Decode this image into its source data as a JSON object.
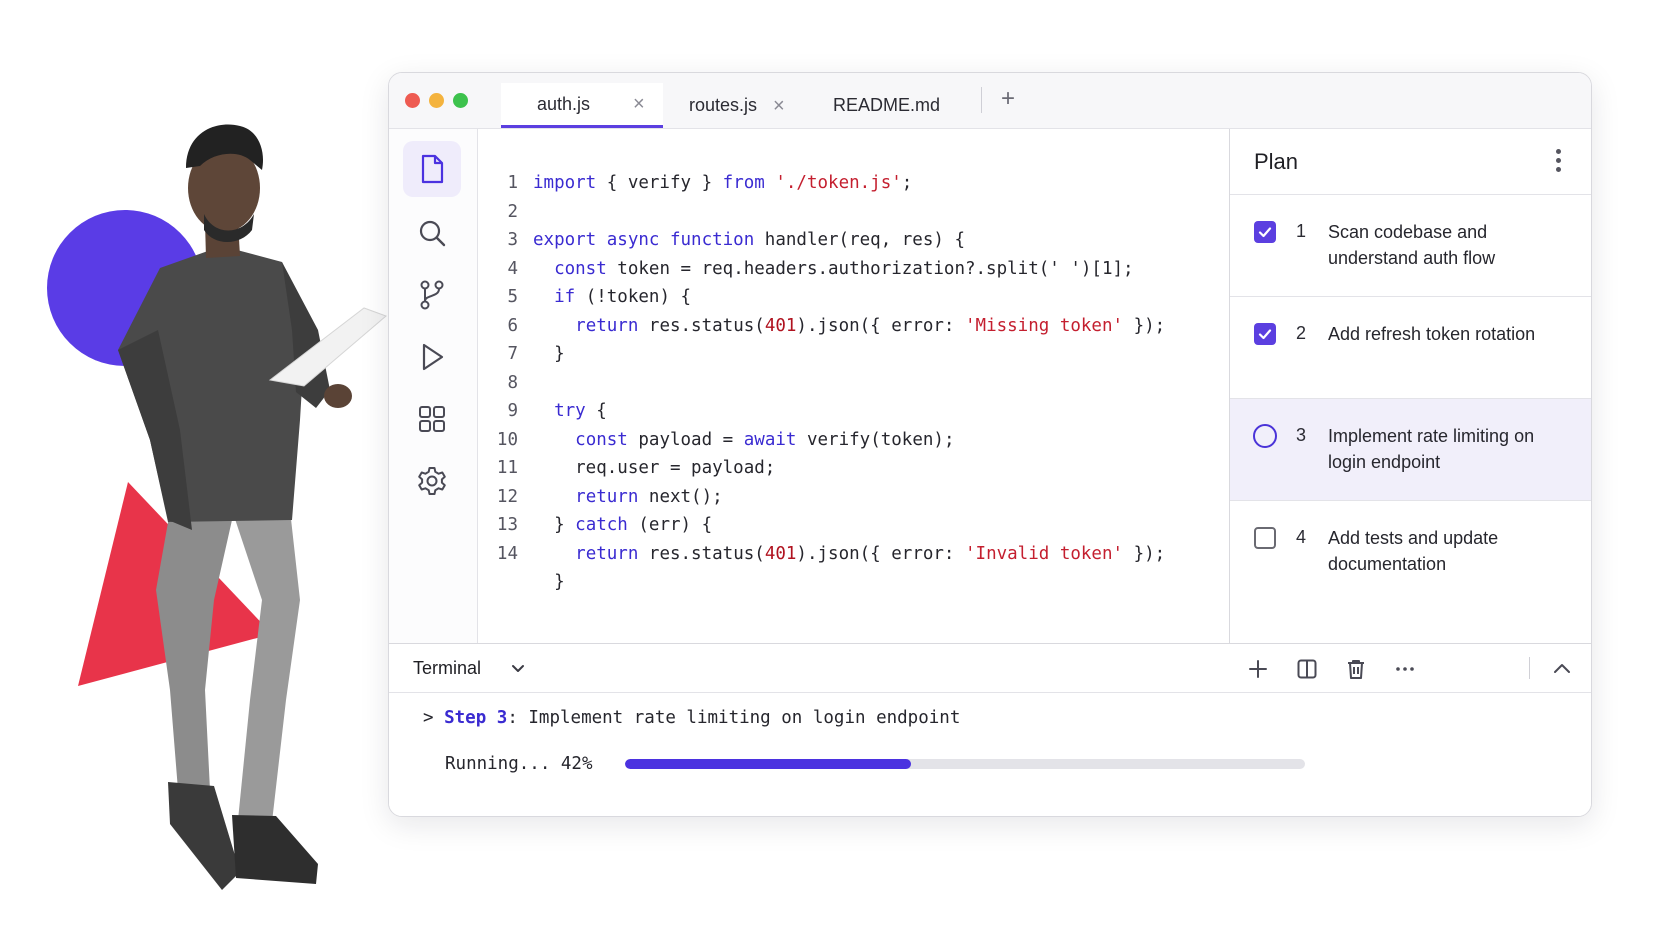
{
  "window": {
    "tabs": [
      {
        "label": "auth.js",
        "active": true
      },
      {
        "label": "routes.js",
        "active": false
      },
      {
        "label": "README.md",
        "active": false
      }
    ],
    "new_tab_label": "+",
    "tab_close_glyph": "×"
  },
  "activity_bar": {
    "icons": [
      "file-icon",
      "search-icon",
      "source-control-icon",
      "run-icon",
      "extensions-icon",
      "settings-icon"
    ],
    "active": "file-icon"
  },
  "editor": {
    "lines": [
      {
        "n": "1",
        "parts": [
          [
            "kw",
            "import"
          ],
          [
            "t",
            " { verify } "
          ],
          [
            "kw",
            "from"
          ],
          [
            "t",
            " "
          ],
          [
            "str",
            "'./token.js'"
          ],
          [
            "t",
            ";"
          ]
        ]
      },
      {
        "n": "2",
        "parts": []
      },
      {
        "n": "3",
        "parts": [
          [
            "kw",
            "export async function"
          ],
          [
            "t",
            " handler(req, res) {"
          ]
        ]
      },
      {
        "n": "4",
        "parts": [
          [
            "t",
            "  "
          ],
          [
            "kw",
            "const"
          ],
          [
            "t",
            " token = req.headers.authorization?.split(' ')[1];"
          ]
        ]
      },
      {
        "n": "5",
        "parts": [
          [
            "t",
            "  "
          ],
          [
            "kw",
            "if"
          ],
          [
            "t",
            " (!token) {"
          ]
        ]
      },
      {
        "n": "6",
        "parts": [
          [
            "t",
            "    "
          ],
          [
            "kw",
            "return"
          ],
          [
            "t",
            " res.status("
          ],
          [
            "num",
            "401"
          ],
          [
            "t",
            ").json({ error: "
          ],
          [
            "str",
            "'Missing token'"
          ],
          [
            "t",
            " });"
          ]
        ]
      },
      {
        "n": "7",
        "parts": [
          [
            "t",
            "  }"
          ]
        ]
      },
      {
        "n": "8",
        "parts": []
      },
      {
        "n": "9",
        "parts": [
          [
            "t",
            "  "
          ],
          [
            "kw",
            "try"
          ],
          [
            "t",
            " {"
          ]
        ]
      },
      {
        "n": "10",
        "parts": [
          [
            "t",
            "    "
          ],
          [
            "kw",
            "const"
          ],
          [
            "t",
            " payload = "
          ],
          [
            "kw",
            "await"
          ],
          [
            "t",
            " verify(token);"
          ]
        ]
      },
      {
        "n": "11",
        "parts": [
          [
            "t",
            "    req.user = payload;"
          ]
        ]
      },
      {
        "n": "12",
        "parts": [
          [
            "t",
            "    "
          ],
          [
            "kw",
            "return"
          ],
          [
            "t",
            " next();"
          ]
        ]
      },
      {
        "n": "13",
        "parts": [
          [
            "t",
            "  } "
          ],
          [
            "kw",
            "catch"
          ],
          [
            "t",
            " (err) {"
          ]
        ]
      },
      {
        "n": "14",
        "parts": [
          [
            "t",
            "    "
          ],
          [
            "kw",
            "return"
          ],
          [
            "t",
            " res.status("
          ],
          [
            "num",
            "401"
          ],
          [
            "t",
            ").json({ error: "
          ],
          [
            "str",
            "'Invalid token'"
          ],
          [
            "t",
            " });"
          ]
        ]
      },
      {
        "n": "",
        "parts": [
          [
            "t",
            "  }"
          ]
        ]
      }
    ]
  },
  "plan": {
    "title": "Plan",
    "menu_icon": "kebab-icon",
    "items": [
      {
        "num": "1",
        "text": "Scan codebase and understand auth flow",
        "status": "done"
      },
      {
        "num": "2",
        "text": "Add refresh token rotation",
        "status": "done"
      },
      {
        "num": "3",
        "text": "Implement rate limiting on login endpoint",
        "status": "in-progress"
      },
      {
        "num": "4",
        "text": "Add tests and update documentation",
        "status": "todo"
      }
    ]
  },
  "terminal": {
    "title": "Terminal",
    "prompt_glyph": ">",
    "step_label": "Step 3",
    "step_text": ": Implement rate limiting on login endpoint",
    "running_text": "Running... 42%",
    "progress": 0.42,
    "tools": [
      "plus-icon",
      "split-icon",
      "trash-icon",
      "more-icon",
      "chevron-up-icon"
    ]
  },
  "colors": {
    "accent": "#5b3fe0",
    "keyword": "#3a2bd1",
    "string": "#c41f2f",
    "deco_circle": "#5a3ce6",
    "deco_triangle": "#e8344a"
  }
}
